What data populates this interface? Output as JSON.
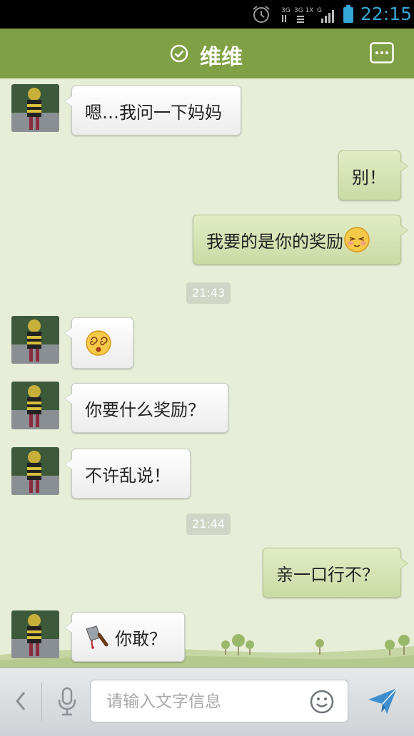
{
  "status_bar": {
    "network_labels": [
      "3G",
      "3G 1X",
      "G"
    ],
    "time": "22:15",
    "time_color": "#35a7d6"
  },
  "header": {
    "title": "维维",
    "online_icon": "check-circle-icon",
    "more_icon": "more-options-icon",
    "accent": "#7fa044"
  },
  "messages": [
    {
      "direction": "in",
      "text": "嗯…我问一下妈妈"
    },
    {
      "direction": "out",
      "text": "别！"
    },
    {
      "direction": "out",
      "text": "我要的是你的奖励",
      "emoji": "shy-face-emoji"
    },
    {
      "type": "timestamp",
      "text": "21:43"
    },
    {
      "direction": "in",
      "text": "",
      "emoji": "dizzy-face-emoji"
    },
    {
      "direction": "in",
      "text": "你要什么奖励？"
    },
    {
      "direction": "in",
      "text": "不许乱说！"
    },
    {
      "type": "timestamp",
      "text": "21:44"
    },
    {
      "direction": "out",
      "text": "亲一口行不？"
    },
    {
      "direction": "in",
      "text": "你敢？",
      "emoji": "cleaver-icon"
    }
  ],
  "input_bar": {
    "placeholder": "请输入文字信息",
    "value": "",
    "back_icon": "chevron-left-icon",
    "voice_icon": "microphone-icon",
    "emoji_icon": "smiley-icon",
    "send_icon": "send-icon"
  }
}
